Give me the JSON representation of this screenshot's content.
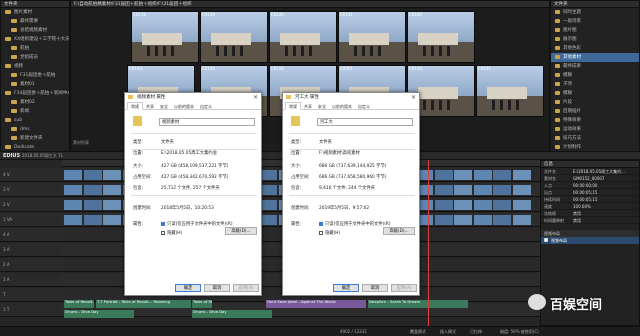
{
  "library": {
    "title": "文件夹",
    "tree": [
      "图片素材",
      "最终需要",
      "总结视频素材",
      "XX组织建设＋工学院十大乐＋航拍",
      "航拍",
      "党组成员",
      "视频",
      "F31届团委＋航拍",
      "素材01",
      "F34届团委＋航拍＋新闻中心",
      "素材02",
      "新闻",
      "sub",
      "dms",
      "新建文件夹",
      "Dedicate"
    ],
    "path": "F:\\自动航拍精素材\\F31届团＋航拍＋组织/F:\\31届团＋组织",
    "thumbs": [
      {
        "label": "C0118"
      },
      {
        "label": "C0139"
      },
      {
        "label": "C0140"
      },
      {
        "label": "C0141"
      },
      {
        "label": "C0142"
      },
      {
        "label": "C0143"
      },
      {
        "label": "C0144"
      },
      {
        "label": "C0156"
      },
      {
        "label": "C0001"
      },
      {
        "label": "C0148"
      },
      {
        "label": "C0031"
      }
    ],
    "bottom_label": "素材列表"
  },
  "right_panel": {
    "title": "文件夹",
    "items": [
      "同时主题",
      "一般场景",
      "图片图",
      "展示图",
      "其他色彩",
      "其他素材",
      "最终成果",
      "模糊",
      "子项",
      "模糊",
      "片段",
      "后期插片",
      "特殊效果",
      "运动效果",
      "技巧方法",
      "计划制作"
    ],
    "selected_index": 5
  },
  "dialog1": {
    "title": "视频素材 属性",
    "tabs": [
      "常规",
      "共享",
      "安全",
      "以前的版本",
      "自定义"
    ],
    "name": "视频素材",
    "rows": [
      {
        "k": "类型:",
        "v": "文件夹"
      },
      {
        "k": "位置:",
        "v": "E:\\2018.05.05周工大集约会"
      },
      {
        "k": "大小:",
        "v": "427 GB (458,109,537,221 字节)"
      },
      {
        "k": "占用空间:",
        "v": "427 GB (458,342,670,592 字节)"
      },
      {
        "k": "包含:",
        "v": "25,712 个文件, 257 个文件夹"
      },
      {
        "k": "创建时间:",
        "v": "2018年5月5日，10:20:53"
      },
      {
        "k": "属性:",
        "v": "只读(仅应用于文件夹中的文件)(R)"
      }
    ],
    "hidden_label": "隐藏(H)",
    "advanced_label": "高级(D)...",
    "ok": "确定",
    "cancel": "取消",
    "apply": "应用(A)"
  },
  "dialog2": {
    "title": "河工大 属性",
    "tabs": [
      "常规",
      "共享",
      "安全",
      "以前的版本",
      "自定义"
    ],
    "name": "河工大",
    "rows": [
      {
        "k": "类型:",
        "v": "文件夹"
      },
      {
        "k": "位置:",
        "v": "F:\\视频素材\\高校素材"
      },
      {
        "k": "大小:",
        "v": "686 GB (737,639,144,925 字节)"
      },
      {
        "k": "占用空间:",
        "v": "686 GB (737,658,580,960 字节)"
      },
      {
        "k": "包含:",
        "v": "9,416 个文件, 244 个文件夹"
      },
      {
        "k": "创建时间:",
        "v": "2019年5月5日，9:57:02"
      },
      {
        "k": "属性:",
        "v": "只读(仅应用于文件夹中的文件)(R)"
      }
    ],
    "hidden_label": "隐藏(H)",
    "advanced_label": "高级(D)...",
    "ok": "确定",
    "cancel": "取消",
    "apply": "应用(A)"
  },
  "edius": {
    "logo": "EDIUS",
    "project": "2018.05.05周工大 TL",
    "tracks": [
      "4 V",
      "3 V",
      "2 V",
      "1 VA",
      "4 A",
      "3 A",
      "2 A",
      "1 A",
      "T",
      "1 T"
    ],
    "clips": [
      {
        "label": "Tales of Revolt...",
        "type": "a"
      },
      {
        "label": "T.T Portrait - Tales of Revolt... Roaming",
        "type": "a"
      },
      {
        "label": "Tales of Revolt...",
        "type": "a"
      },
      {
        "label": "Hunt Save Jebel - Against The World",
        "type": "t"
      },
      {
        "label": "DeepSen - Sarah To Dream",
        "type": "a"
      },
      {
        "label": "Drums - Diva Day",
        "type": "a"
      },
      {
        "label": "Drums - Diva Day",
        "type": "a"
      }
    ],
    "status_left": "4902 / 13332",
    "status_disk": "磁盘: 59% 被使用(C)",
    "status_mid": "覆盖模式",
    "status_mid2": "插入模式",
    "status_mid3": "已拉伸"
  },
  "info_panel": {
    "title": "信息",
    "rows": [
      {
        "k": "文件名",
        "v": "E:\\2018.05.05周工大集约..."
      },
      {
        "k": "素材名",
        "v": "GM0152_00007"
      },
      {
        "k": "入点",
        "v": "00:00:00;00"
      },
      {
        "k": "出点",
        "v": "00:00:05;15"
      },
      {
        "k": "持续时间",
        "v": "00:00:05;15"
      },
      {
        "k": "速度",
        "v": "100.00%"
      },
      {
        "k": "冻结帧",
        "v": "禁用"
      },
      {
        "k": "时间重映射",
        "v": "禁用"
      }
    ],
    "effects_label": "视频布局",
    "effect_item": "视频布局"
  },
  "watermark": "百娱空间"
}
